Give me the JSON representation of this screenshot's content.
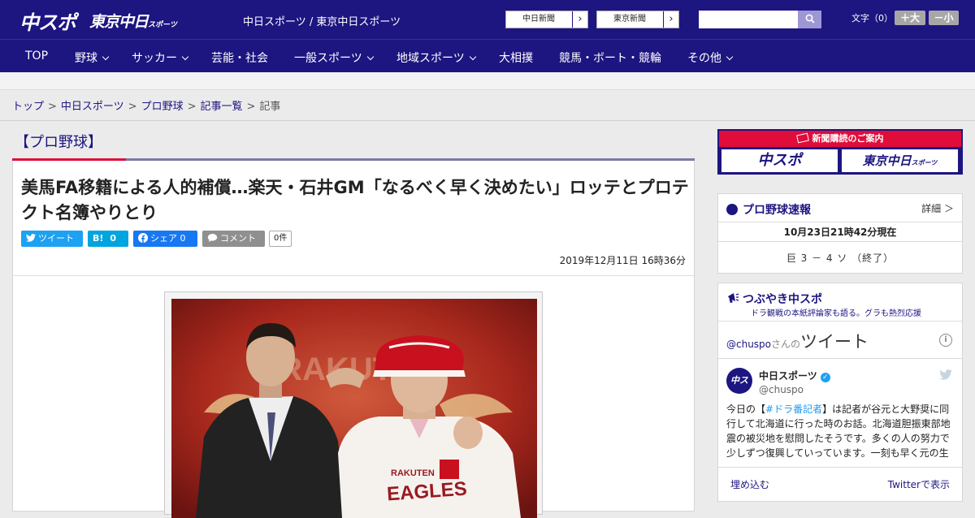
{
  "header": {
    "logo_main": "中スポ",
    "logo_tokyo": "東京中日",
    "logo_tokyo_sub": "スポーツ",
    "site_title": "中日スポーツ / 東京中日スポーツ",
    "paper_buttons": [
      "中日新聞",
      "東京新聞"
    ],
    "search_placeholder": "",
    "font_size_label": "文字（0）",
    "font_bigger": "＋大",
    "font_smaller": "－小"
  },
  "nav": {
    "items": [
      {
        "label": "TOP",
        "dropdown": false
      },
      {
        "label": "野球",
        "dropdown": true
      },
      {
        "label": "サッカー",
        "dropdown": true
      },
      {
        "label": "芸能・社会",
        "dropdown": false
      },
      {
        "label": "一般スポーツ",
        "dropdown": true
      },
      {
        "label": "地域スポーツ",
        "dropdown": true
      },
      {
        "label": "大相撲",
        "dropdown": false
      },
      {
        "label": "競馬・ボート・競輪",
        "dropdown": false
      },
      {
        "label": "その他",
        "dropdown": true
      }
    ]
  },
  "breadcrumb": {
    "links": [
      "トップ",
      "中日スポーツ",
      "プロ野球",
      "記事一覧"
    ],
    "current": "記事",
    "separator": ">"
  },
  "article": {
    "category": "【プロ野球】",
    "headline": "美馬FA移籍による人的補償…楽天・石井GM「なるべく早く決めたい」ロッテとプロテクト名簿やりとり",
    "share": {
      "tweet": "ツイート",
      "hatena_count": "0",
      "facebook": "シェア 0",
      "comment": "コメント",
      "comment_count": "0件"
    },
    "date": "2019年12月11日 16時36分"
  },
  "sidebar": {
    "subscribe_title": "新聞購読のご案内",
    "subscribe_logo1": "中スポ",
    "subscribe_logo2": "東京中日",
    "subscribe_logo2_sub": "スポーツ",
    "score_title": "プロ野球速報",
    "score_more": "詳細 ＞",
    "score_time": "10月23日21時42分現在",
    "score_line": "巨 3 － 4 ソ （終了）",
    "tweets_title": "つぶやき中スポ",
    "tweets_sub": "ドラ観戦の本紙評論家も語る。グラも熱烈応援",
    "tw_handle_head": "@chuspo",
    "tw_san": "さんの",
    "tw_tweet": "ツイート",
    "tw_name": "中日スポーツ",
    "tw_avatar": "中スポ",
    "tw_handle": "@chuspo",
    "tw_text_pre": "今日の【",
    "tw_hashtag": "#ドラ番記者",
    "tw_text_post": "】は記者が谷元と大野奨に同行して北海道に行った時のお話。北海道胆振東部地震の被災地を慰問したそうです。多くの人の努力で少しずつ復興していっています。一刻も早く元の生",
    "tw_embed": "埋め込む",
    "tw_view": "Twitterで表示"
  },
  "colors": {
    "brand_navy": "#1d1580",
    "accent_red": "#e00c3a",
    "twitter_blue": "#1da1f2",
    "facebook_blue": "#1877f2"
  }
}
